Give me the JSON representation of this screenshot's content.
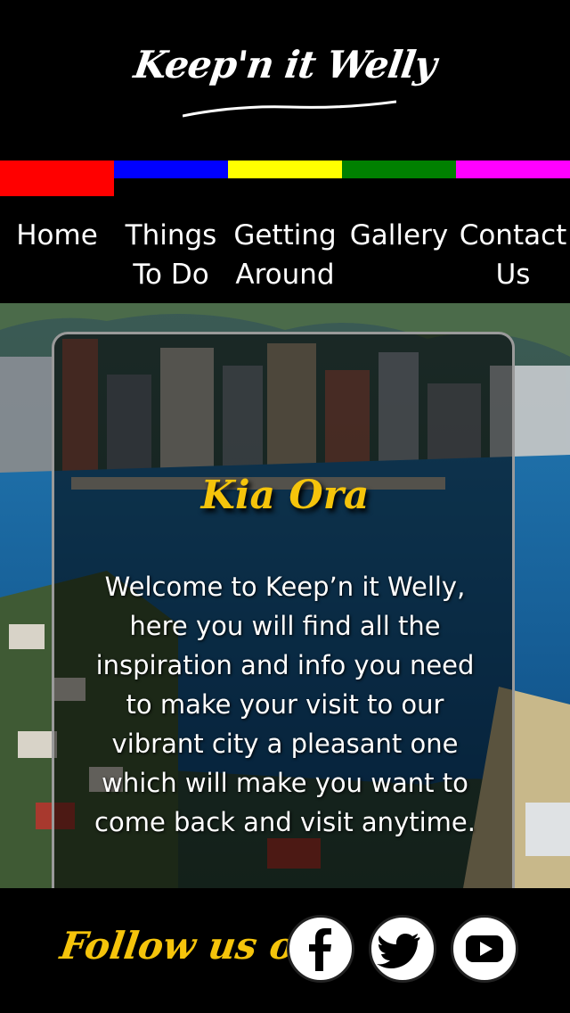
{
  "header": {
    "logo_text": "Keep'n it Welly"
  },
  "colorbar": {
    "colors": [
      "#ff0000",
      "#0000ff",
      "#ffff00",
      "#008000",
      "#ff00ff"
    ],
    "active_index": 0
  },
  "nav": {
    "items": [
      {
        "label": "Home"
      },
      {
        "label": "Things To Do"
      },
      {
        "label": "Getting Around"
      },
      {
        "label": "Gallery"
      },
      {
        "label": "Contact Us"
      }
    ]
  },
  "card": {
    "title": "Kia Ora",
    "body": "Welcome to Keep’n it Welly, here you will find all the inspiration and info you need to make your visit to our vibrant city a pleasant one which will make you want to come back and visit anytime."
  },
  "footer": {
    "follow_label": "Follow us on:",
    "social": [
      {
        "icon": "facebook-icon"
      },
      {
        "icon": "twitter-icon"
      },
      {
        "icon": "youtube-icon"
      }
    ]
  },
  "colors": {
    "accent": "#f5c40b",
    "background": "#000000"
  }
}
